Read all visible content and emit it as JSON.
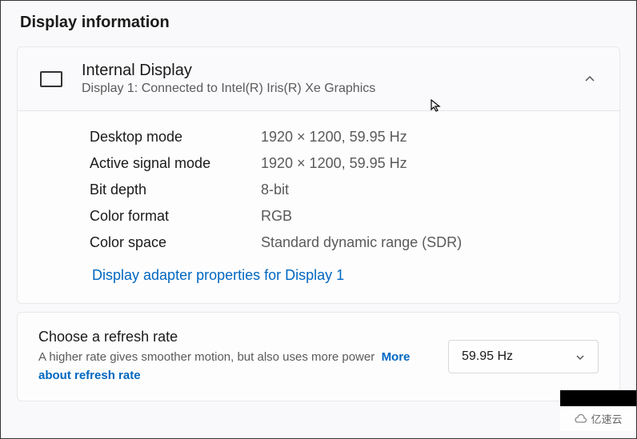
{
  "section_title": "Display information",
  "display_card": {
    "title": "Internal Display",
    "subtitle": "Display 1: Connected to Intel(R) Iris(R) Xe Graphics",
    "properties": [
      {
        "label": "Desktop mode",
        "value": "1920 × 1200, 59.95 Hz"
      },
      {
        "label": "Active signal mode",
        "value": "1920 × 1200, 59.95 Hz"
      },
      {
        "label": "Bit depth",
        "value": "8-bit"
      },
      {
        "label": "Color format",
        "value": "RGB"
      },
      {
        "label": "Color space",
        "value": "Standard dynamic range (SDR)"
      }
    ],
    "adapter_link": "Display adapter properties for Display 1"
  },
  "refresh_rate": {
    "title": "Choose a refresh rate",
    "description": "A higher rate gives smoother motion, but also uses more power",
    "more_link": "More about refresh rate",
    "selected": "59.95 Hz"
  },
  "watermark": "亿速云"
}
